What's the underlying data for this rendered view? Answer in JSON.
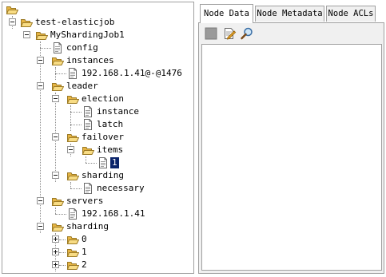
{
  "tree": {
    "root": {
      "label": "",
      "icon": "folder-open-icon"
    },
    "nodes": {
      "test_elasticjob": "test-elasticjob",
      "my_sharding_job": "MyShardingJob1",
      "config": "config",
      "instances": "instances",
      "instance_ip": "192.168.1.41@-@1476",
      "leader": "leader",
      "election": "election",
      "election_instance": "instance",
      "latch": "latch",
      "failover": "failover",
      "items": "items",
      "item_1": "1",
      "leader_sharding": "sharding",
      "necessary": "necessary",
      "servers": "servers",
      "server_ip": "192.168.1.41",
      "sharding": "sharding",
      "shard_0": "0",
      "shard_1": "1",
      "shard_2": "2"
    },
    "selected": "item_1"
  },
  "tabs": [
    {
      "label": "Node Data",
      "active": true
    },
    {
      "label": "Node Metadata",
      "active": false
    },
    {
      "label": "Node ACLs",
      "active": false
    }
  ],
  "toolbar": {
    "buttons": [
      {
        "icon": "save-icon",
        "enabled": false
      },
      {
        "icon": "edit-icon",
        "enabled": true
      },
      {
        "icon": "search-icon",
        "enabled": true
      }
    ]
  },
  "node_data": {
    "value": ""
  },
  "colors": {
    "selection": "#0a246a",
    "folder": "#f0c858",
    "tree_lines": "#8c8c8c"
  }
}
